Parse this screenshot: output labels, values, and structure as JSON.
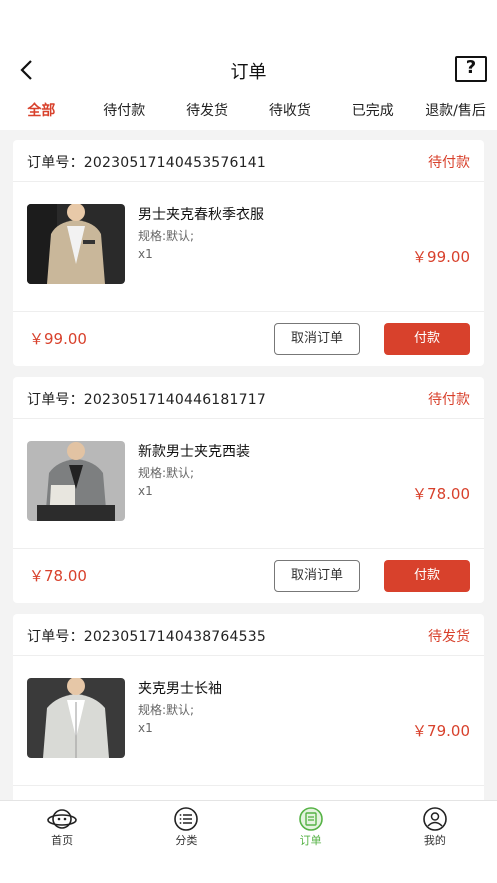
{
  "header": {
    "title": "订单",
    "help_label": "?"
  },
  "tabs": [
    {
      "label": "全部"
    },
    {
      "label": "待付款"
    },
    {
      "label": "待发货"
    },
    {
      "label": "待收货"
    },
    {
      "label": "已完成"
    },
    {
      "label": "退款/售后"
    }
  ],
  "orders": [
    {
      "order_no": "订单号：20230517140453576141",
      "status": "待付款",
      "product_name": "男士夹克春秋季衣服",
      "spec": "规格:默认;",
      "qty": "x1",
      "price": "￥99.00",
      "total": "￥99.00",
      "cancel_label": "取消订单",
      "pay_label": "付款"
    },
    {
      "order_no": "订单号：20230517140446181717",
      "status": "待付款",
      "product_name": "新款男士夹克西装",
      "spec": "规格:默认;",
      "qty": "x1",
      "price": "￥78.00",
      "total": "￥78.00",
      "cancel_label": "取消订单",
      "pay_label": "付款"
    },
    {
      "order_no": "订单号：20230517140438764535",
      "status": "待发货",
      "product_name": "夹克男士长袖",
      "spec": "规格:默认;",
      "qty": "x1",
      "price": "￥79.00"
    }
  ],
  "tabbar": [
    {
      "label": "首页",
      "icon": "planet-icon"
    },
    {
      "label": "分类",
      "icon": "list-icon"
    },
    {
      "label": "订单",
      "icon": "order-icon"
    },
    {
      "label": "我的",
      "icon": "user-icon"
    }
  ],
  "colors": {
    "accent": "#d8412c",
    "tab_active": "#55b245"
  }
}
